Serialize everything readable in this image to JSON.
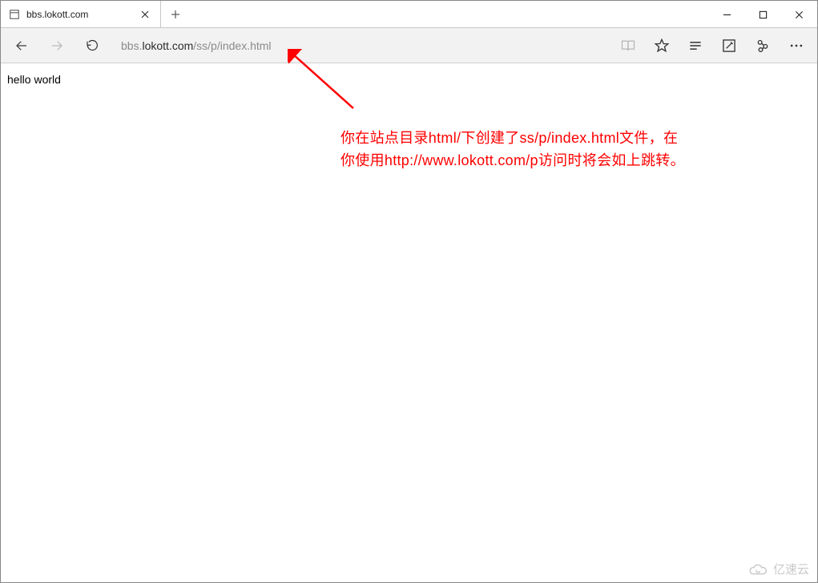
{
  "window": {
    "minimize_label": "Minimize",
    "maximize_label": "Maximize",
    "close_label": "Close"
  },
  "tabs": [
    {
      "title": "bbs.lokott.com"
    }
  ],
  "nav": {
    "back": "Back",
    "forward": "Forward",
    "refresh": "Refresh"
  },
  "address": {
    "dim_prefix": "bbs.",
    "main": "lokott.com",
    "dim_suffix": "/ss/p/index.html"
  },
  "right_icons": {
    "reading": "Reading view",
    "favorite": "Add to favorites",
    "hub": "Hub",
    "notes": "Make a web note",
    "share": "Share",
    "more": "Settings and more"
  },
  "page": {
    "body_text": "hello world"
  },
  "annotation": {
    "text": "你在站点目录html/下创建了ss/p/index.html文件，在你使用http://www.lokott.com/p访问时将会如上跳转。"
  },
  "watermark": {
    "text": "亿速云"
  }
}
